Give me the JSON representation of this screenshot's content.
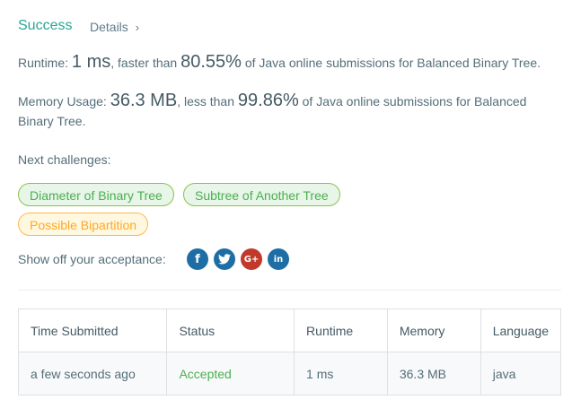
{
  "header": {
    "status": "Success",
    "details_label": "Details",
    "details_chevron": "›"
  },
  "runtime": {
    "label": "Runtime: ",
    "value": "1 ms",
    "connector": ", faster than ",
    "percent": "80.55%",
    "suffix": " of Java online submissions for Balanced Binary Tree."
  },
  "memory": {
    "label": "Memory Usage: ",
    "value": "36.3 MB",
    "connector": ", less than ",
    "percent": "99.86%",
    "suffix": " of Java online submissions for Balanced Binary Tree."
  },
  "next": {
    "label": "Next challenges:",
    "items": [
      {
        "label": "Diameter of Binary Tree",
        "difficulty_color": "green"
      },
      {
        "label": "Subtree of Another Tree",
        "difficulty_color": "green"
      },
      {
        "label": "Possible Bipartition",
        "difficulty_color": "orange"
      }
    ]
  },
  "share": {
    "label": "Show off your acceptance:",
    "icons": [
      {
        "name": "facebook-icon",
        "glyph": "f"
      },
      {
        "name": "twitter-icon",
        "glyph": "t"
      },
      {
        "name": "google-plus-icon",
        "glyph": "G+"
      },
      {
        "name": "linkedin-icon",
        "glyph": "in"
      }
    ]
  },
  "table": {
    "headers": [
      "Time Submitted",
      "Status",
      "Runtime",
      "Memory",
      "Language"
    ],
    "rows": [
      [
        "a few seconds ago",
        "Accepted",
        "1 ms",
        "36.3 MB",
        "java"
      ]
    ]
  },
  "colors": {
    "success": "#26a69a",
    "social_blue": "#1e6ea5",
    "accepted": "#4caf50",
    "tag_green": "#8bc34a",
    "tag_orange": "#ffb74d"
  }
}
